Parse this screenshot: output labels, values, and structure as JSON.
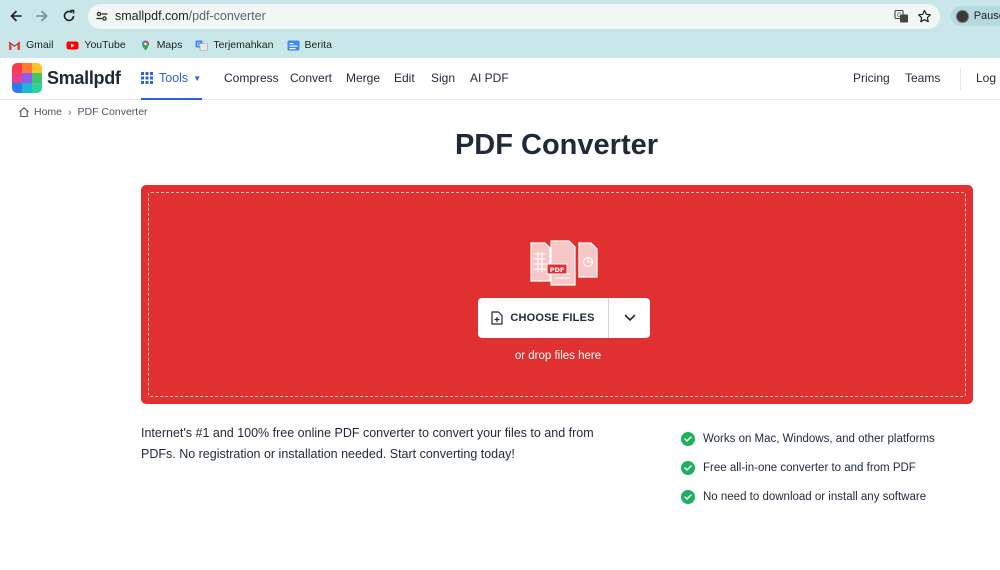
{
  "browser": {
    "url_host": "smallpdf.com",
    "url_path": "/pdf-converter",
    "profile_label": "Paused",
    "bookmarks": [
      {
        "label": "Gmail",
        "icon": "gmail-icon"
      },
      {
        "label": "YouTube",
        "icon": "youtube-icon"
      },
      {
        "label": "Maps",
        "icon": "maps-icon"
      },
      {
        "label": "Terjemahkan",
        "icon": "translate-icon"
      },
      {
        "label": "Berita",
        "icon": "news-icon"
      }
    ]
  },
  "site": {
    "logo_text": "Smallpdf",
    "tools_label": "Tools",
    "nav": [
      "Compress",
      "Convert",
      "Merge",
      "Edit",
      "Sign",
      "AI PDF"
    ],
    "right_nav": [
      "Pricing",
      "Teams",
      "Log In"
    ]
  },
  "breadcrumb": {
    "home": "Home",
    "current": "PDF Converter"
  },
  "title": "PDF Converter",
  "dropzone": {
    "choose_label": "CHOOSE FILES",
    "drop_hint": "or drop files here",
    "file_badge": "PDF",
    "color": "#e0302f"
  },
  "description": "Internet's #1 and 100% free online PDF converter to convert your files to and from PDFs. No registration or installation needed. Start converting today!",
  "features": [
    "Works on Mac, Windows, and other platforms",
    "Free all-in-one converter to and from PDF",
    "No need to download or install any software"
  ],
  "colors": {
    "accent": "#2b62d9",
    "check": "#1db05e",
    "chrome": "#c9e7e9"
  }
}
